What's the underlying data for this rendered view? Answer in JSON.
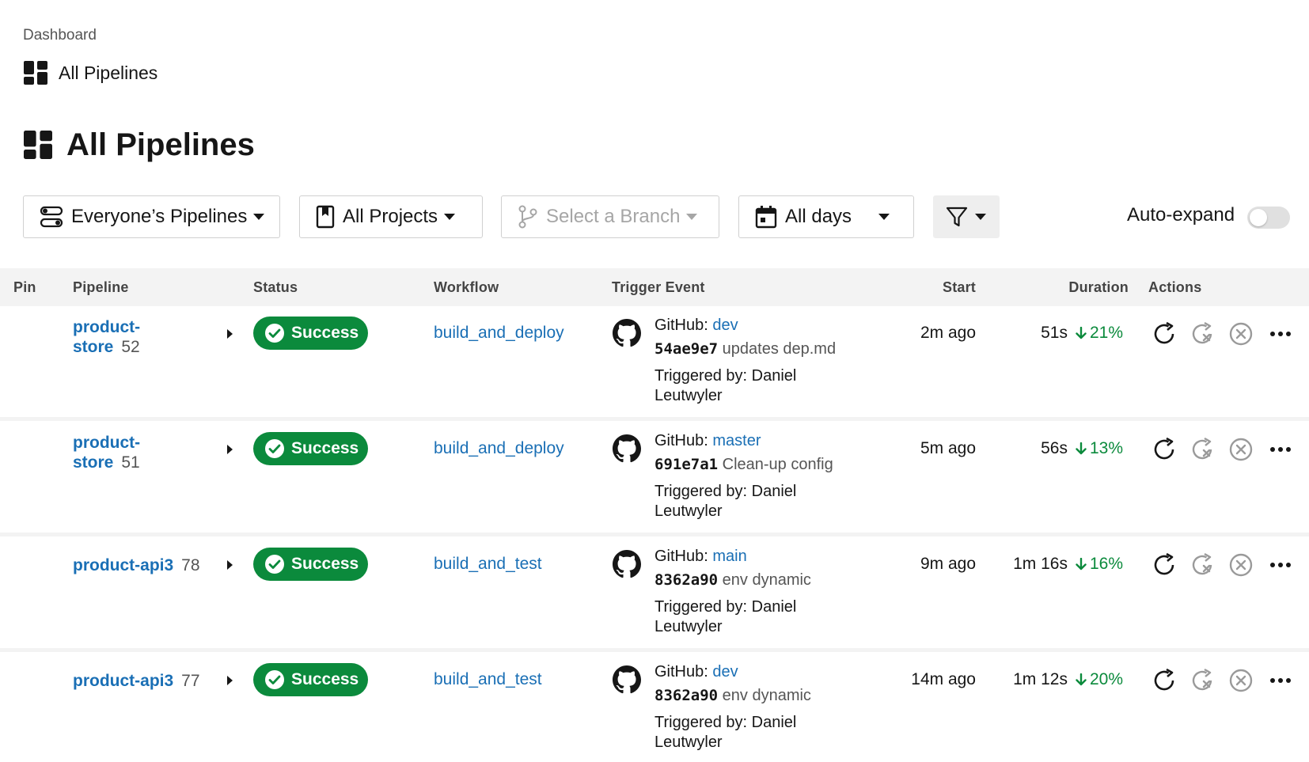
{
  "breadcrumb": {
    "root": "Dashboard",
    "current": "All Pipelines"
  },
  "page_title": "All Pipelines",
  "filters": {
    "pipelines": "Everyone’s Pipelines",
    "projects": "All Projects",
    "branch_placeholder": "Select a Branch",
    "days": "All days",
    "auto_expand_label": "Auto-expand",
    "auto_expand_on": false
  },
  "table": {
    "headers": {
      "pin": "Pin",
      "pipeline": "Pipeline",
      "status": "Status",
      "workflow": "Workflow",
      "trigger": "Trigger Event",
      "start": "Start",
      "duration": "Duration",
      "actions": "Actions"
    },
    "rows": [
      {
        "pipeline_line1": "product-",
        "pipeline_line2": "store",
        "number": "52",
        "status": "Success",
        "workflow": "build_and_deploy",
        "source": "GitHub:",
        "branch": "dev",
        "sha": "54ae9e7",
        "message": "updates dep.md",
        "triggered_line1": "Triggered by: Daniel",
        "triggered_line2": "Leutwyler",
        "start": "2m ago",
        "duration": "51s",
        "change": "21%"
      },
      {
        "pipeline_line1": "product-",
        "pipeline_line2": "store",
        "number": "51",
        "status": "Success",
        "workflow": "build_and_deploy",
        "source": "GitHub:",
        "branch": "master",
        "sha": "691e7a1",
        "message": "Clean-up config",
        "triggered_line1": "Triggered by: Daniel",
        "triggered_line2": "Leutwyler",
        "start": "5m ago",
        "duration": "56s",
        "change": "13%"
      },
      {
        "pipeline_line1": "product-api3",
        "pipeline_line2": "",
        "number": "78",
        "status": "Success",
        "workflow": "build_and_test",
        "source": "GitHub:",
        "branch": "main",
        "sha": "8362a90",
        "message": "env dynamic",
        "triggered_line1": "Triggered by: Daniel",
        "triggered_line2": "Leutwyler",
        "start": "9m ago",
        "duration": "1m 16s",
        "change": "16%"
      },
      {
        "pipeline_line1": "product-api3",
        "pipeline_line2": "",
        "number": "77",
        "status": "Success",
        "workflow": "build_and_test",
        "source": "GitHub:",
        "branch": "dev",
        "sha": "8362a90",
        "message": "env dynamic",
        "triggered_line1": "Triggered by: Daniel",
        "triggered_line2": "Leutwyler",
        "start": "14m ago",
        "duration": "1m 12s",
        "change": "20%"
      }
    ]
  },
  "colors": {
    "success": "#0b8a3c",
    "link": "#1a6fb5",
    "header_bg": "#f3f3f3"
  },
  "icons": [
    "dashboard-icon",
    "pipelines-filter-icon",
    "project-icon",
    "branch-icon",
    "calendar-icon",
    "filter-icon",
    "check-circle-icon",
    "github-icon",
    "arrow-down-icon",
    "rerun-icon",
    "rerun-failed-icon",
    "cancel-icon",
    "more-icon"
  ]
}
